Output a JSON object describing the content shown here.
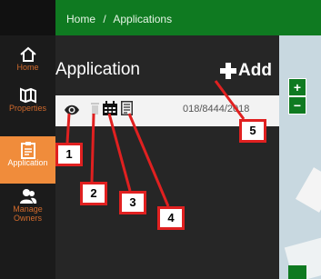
{
  "breadcrumb": {
    "home": "Home",
    "separator": "/",
    "current": "Applications"
  },
  "sidebar": {
    "items": [
      {
        "label": "Home",
        "icon": "home-icon",
        "active": false
      },
      {
        "label": "Properties",
        "icon": "map-icon",
        "active": false
      },
      {
        "label": "Application",
        "icon": "clipboard-icon",
        "active": true
      },
      {
        "label": "Manage Owners",
        "icon": "users-icon",
        "active": false
      }
    ]
  },
  "main": {
    "title": "Application",
    "add_label": "Add",
    "row": {
      "actions": [
        "eye-icon",
        "trash-icon",
        "calendar-icon",
        "document-icon"
      ],
      "reference": "018/8444/2018"
    }
  },
  "map": {
    "zoom_in": "+",
    "zoom_out": "−"
  },
  "annotations": [
    "1",
    "2",
    "3",
    "4",
    "5"
  ],
  "colors": {
    "header_green": "#0f7a21",
    "sidebar_bg": "#1b1b1b",
    "active_orange": "#f08c3b",
    "accent_orange_text": "#d16a2c",
    "annotation_red": "#e02020"
  }
}
